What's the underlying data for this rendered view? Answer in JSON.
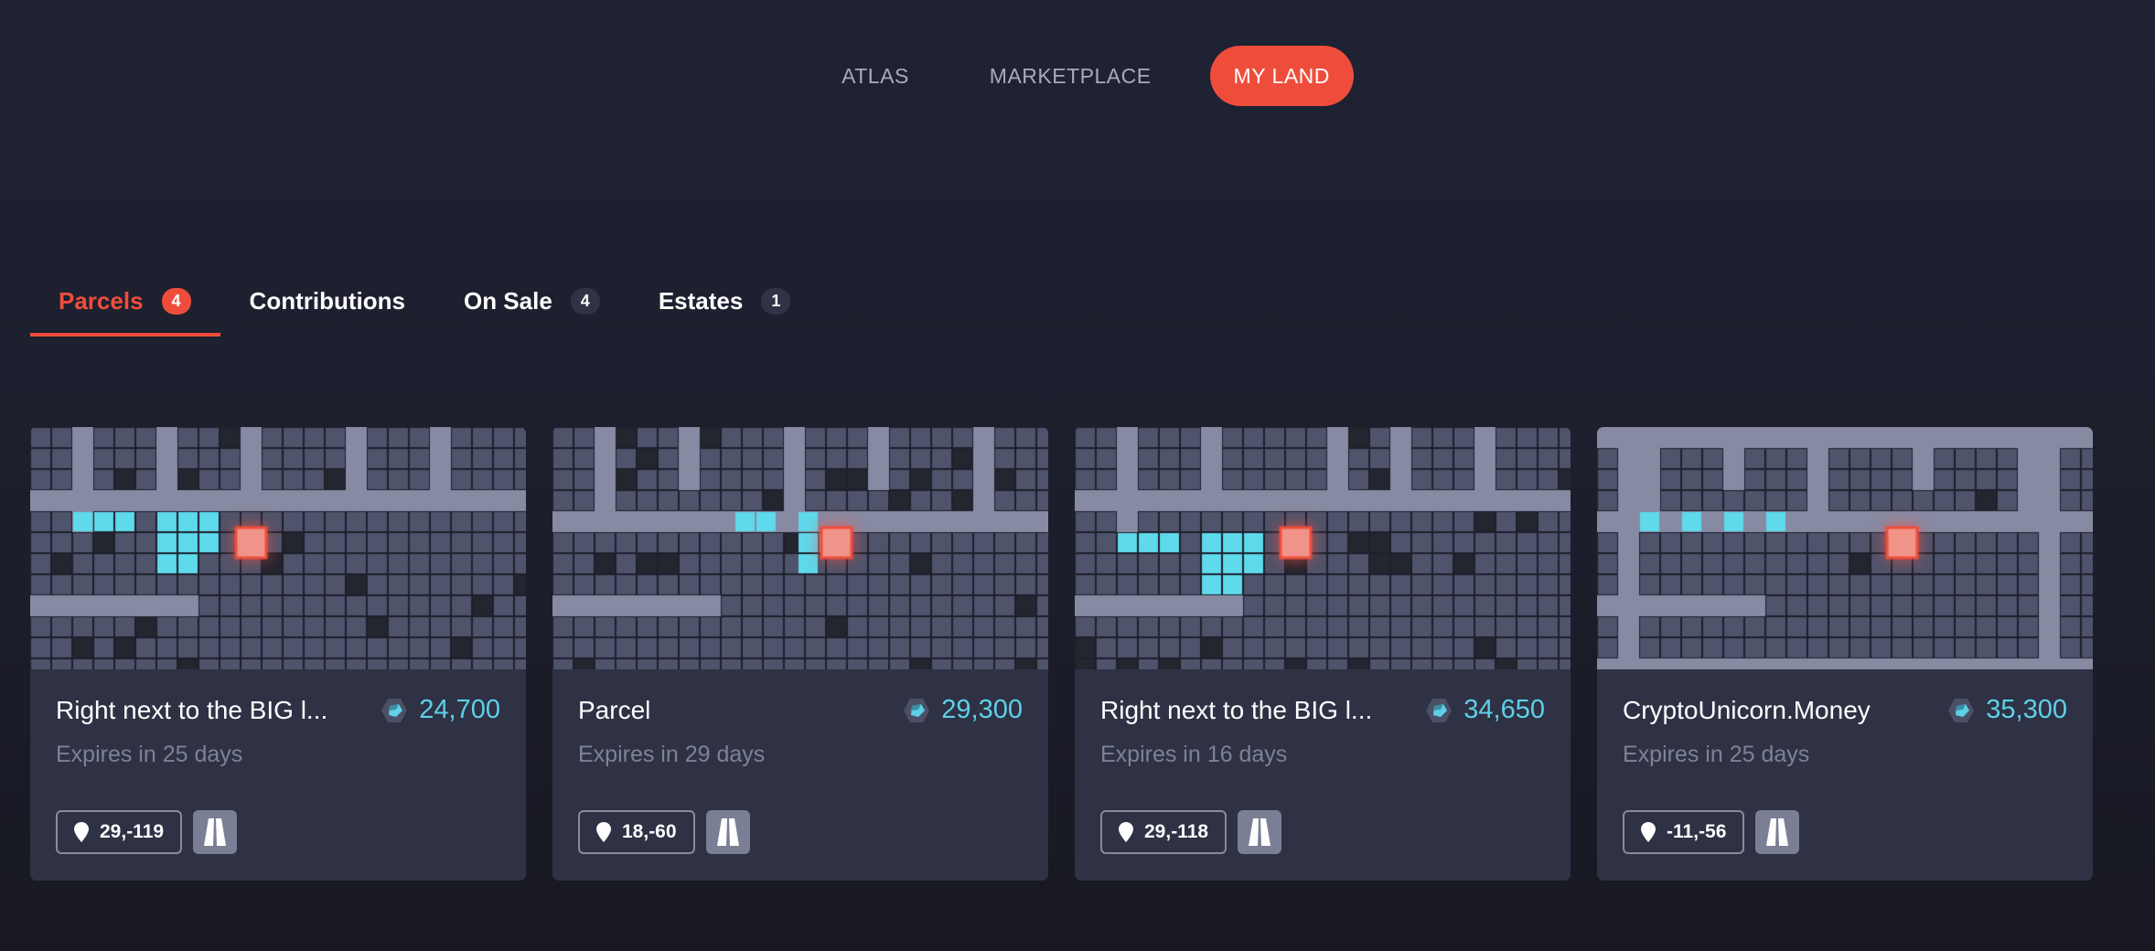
{
  "nav": {
    "items": [
      {
        "label": "ATLAS",
        "active": false
      },
      {
        "label": "MARKETPLACE",
        "active": false
      },
      {
        "label": "MY LAND",
        "active": true
      }
    ]
  },
  "tabs": [
    {
      "label": "Parcels",
      "count": "4",
      "active": true
    },
    {
      "label": "Contributions",
      "count": null,
      "active": false
    },
    {
      "label": "On Sale",
      "count": "4",
      "active": false
    },
    {
      "label": "Estates",
      "count": "1",
      "active": false
    }
  ],
  "colors": {
    "accent": "#ef4d3c",
    "mana": "#5fd0e8",
    "road": "#878aa3",
    "parcel": "#4f536b",
    "owned": "#5fd9ec",
    "selected": "#f0948a"
  },
  "cards": [
    {
      "title": "Right next to the BIG l...",
      "price": "24,700",
      "expires": "Expires in 25 days",
      "coords": "29,-119",
      "icon": "road-icon"
    },
    {
      "title": "Parcel",
      "price": "29,300",
      "expires": "Expires in 29 days",
      "coords": "18,-60",
      "icon": "road-icon"
    },
    {
      "title": "Right next to the BIG l...",
      "price": "34,650",
      "expires": "Expires in 16 days",
      "coords": "29,-118",
      "icon": "road-icon"
    },
    {
      "title": "CryptoUnicorn.Money",
      "price": "35,300",
      "expires": "Expires in 25 days",
      "coords": "-11,-56",
      "icon": "road-icon"
    }
  ]
}
